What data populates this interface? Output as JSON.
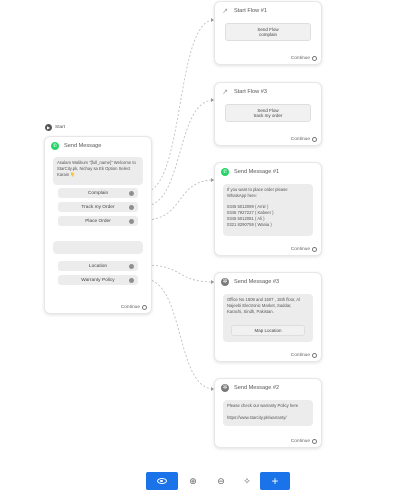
{
  "start": {
    "label": "Start"
  },
  "send_message": {
    "title": "Send Message",
    "body": "Asalam Walikum \"[full_name]\" Welcome to StarCity.pk, Nichay sa Ek Option Select Karain 👇",
    "options": [
      "Complain",
      "Track my Order",
      "Place Order"
    ],
    "options2": [
      "Location",
      "Warranty Policy"
    ],
    "continue_label": "Continue"
  },
  "start_flow_1": {
    "title": "Start Flow #1",
    "button_title": "Send Flow",
    "button_sub": "complain",
    "continue_label": "Continue"
  },
  "start_flow_3": {
    "title": "Start Flow #3",
    "button_title": "Send Flow",
    "button_sub": "track my order",
    "continue_label": "Continue"
  },
  "send_message_1": {
    "title": "Send Message #1",
    "lines": [
      "If you want to place order please",
      "WhatsApp here:",
      "",
      "0345 5012099 ( Amir )",
      "0345 7927227 ( Kabeer )",
      "0345 5012081 ( Ali )",
      "0321 8290759 ( Wania )"
    ],
    "continue_label": "Continue"
  },
  "send_message_3": {
    "title": "Send Message #3",
    "lines": [
      "Office No 1508 and 1507 , 15th floor, Al",
      "Najeebi Electronic Market, Saddar,",
      "Karachi, Sindh, Pakistan."
    ],
    "button_label": "Map Location",
    "continue_label": "Continue"
  },
  "send_message_2": {
    "title": "Send Message #2",
    "lines": [
      "Please check our warranty Policy here",
      "",
      "https://www.starcity.pk/warranty/"
    ],
    "continue_label": "Continue"
  },
  "toolbar": {
    "items": [
      "view-icon",
      "zoom-in-icon",
      "zoom-out-icon",
      "auto-arrange-icon",
      "add-icon"
    ],
    "zoom_in": "⊕",
    "zoom_out": "⊖",
    "arrange": "✧",
    "add": "+",
    "primary_color": "#1a73e8"
  }
}
